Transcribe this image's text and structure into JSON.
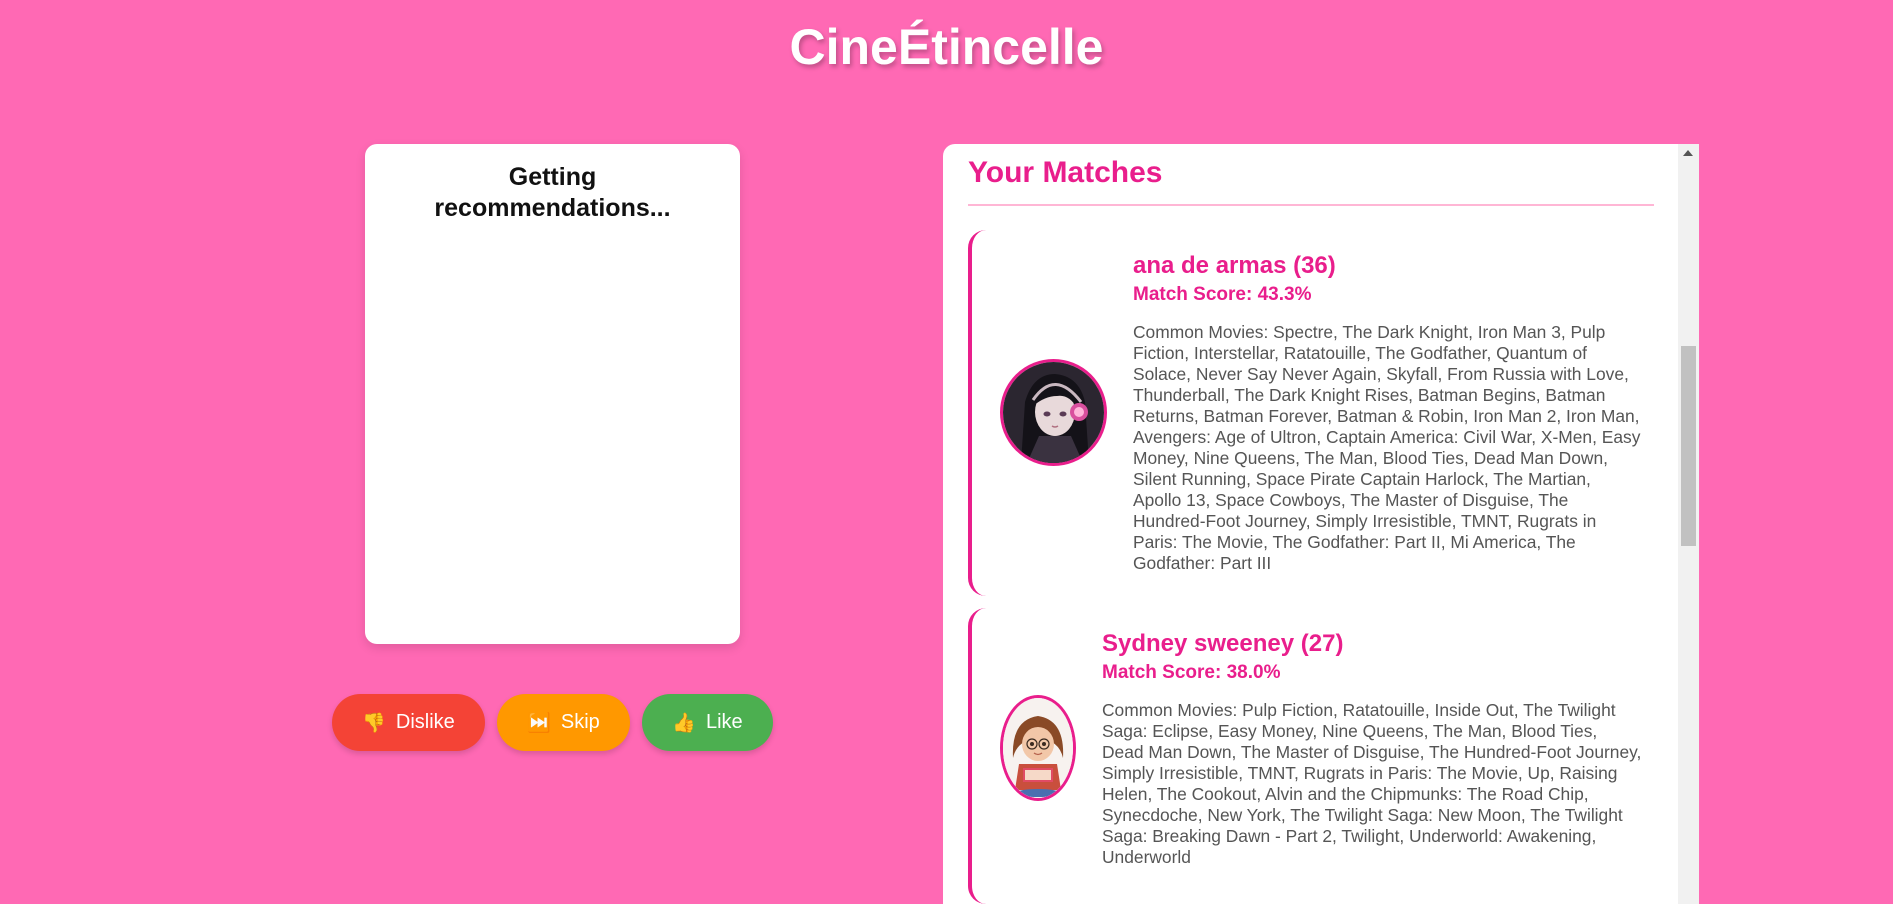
{
  "app": {
    "title": "CineÉtincelle"
  },
  "recommendation": {
    "status": "Getting recommendations..."
  },
  "actions": {
    "dislike": {
      "icon": "👎",
      "label": "Dislike"
    },
    "skip": {
      "icon": "⏭️",
      "label": "Skip"
    },
    "like": {
      "icon": "👍",
      "label": "Like"
    }
  },
  "matches": {
    "title": "Your Matches",
    "items": [
      {
        "name": "ana de armas (36)",
        "score": "Match Score: 43.3%",
        "common_movies": "Common Movies: Spectre, The Dark Knight, Iron Man 3, Pulp Fiction, Interstellar, Ratatouille, The Godfather, Quantum of Solace, Never Say Never Again, Skyfall, From Russia with Love, Thunderball, The Dark Knight Rises, Batman Begins, Batman Returns, Batman Forever, Batman & Robin, Iron Man 2, Iron Man, Avengers: Age of Ultron, Captain America: Civil War, X-Men, Easy Money, Nine Queens, The Man, Blood Ties, Dead Man Down, Silent Running, Space Pirate Captain Harlock, The Martian, Apollo 13, Space Cowboys, The Master of Disguise, The Hundred-Foot Journey, Simply Irresistible, TMNT, Rugrats in Paris: The Movie, The Godfather: Part II, Mi America, The Godfather: Part III",
        "avatar_icon": "anime-girl-headphones-avatar"
      },
      {
        "name": "Sydney sweeney (27)",
        "score": "Match Score: 38.0%",
        "common_movies": "Common Movies: Pulp Fiction, Ratatouille, Inside Out, The Twilight Saga: Eclipse, Easy Money, Nine Queens, The Man, Blood Ties, Dead Man Down, The Master of Disguise, The Hundred-Foot Journey, Simply Irresistible, TMNT, Rugrats in Paris: The Movie, Up, Raising Helen, The Cookout, Alvin and the Chipmunks: The Road Chip, Synecdoche, New York, The Twilight Saga: New Moon, The Twilight Saga: Breaking Dawn - Part 2, Twilight, Underworld: Awakening, Underworld",
        "avatar_icon": "cartoon-girl-reading-avatar"
      }
    ]
  },
  "colors": {
    "background": "#ff69b4",
    "accent": "#e91e8c",
    "dislike": "#f44336",
    "skip": "#ff9800",
    "like": "#4caf50"
  }
}
